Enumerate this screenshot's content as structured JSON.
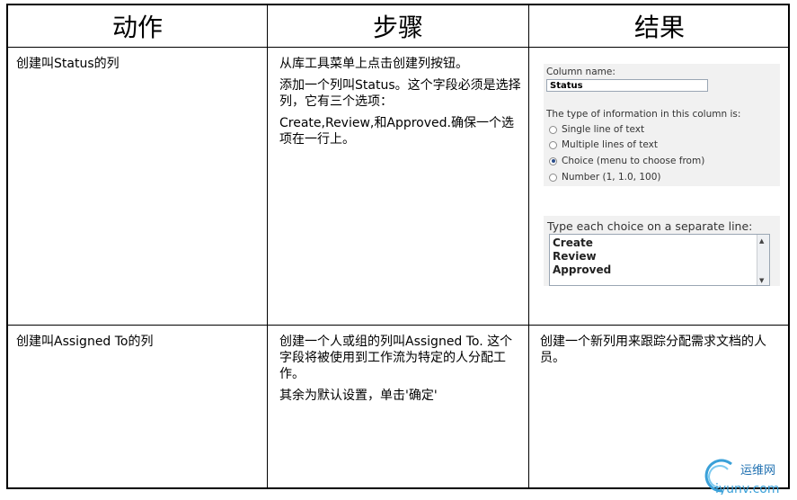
{
  "headers": [
    "动作",
    "步骤",
    "结果"
  ],
  "rows": [
    {
      "action": "创建叫Status的列",
      "steps": [
        "从库工具菜单上点击创建列按钮。",
        "添加一个列叫Status。这个字段必须是选择列，它有三个选项：",
        "Create,Review,和Approved.确保一个选项在一行上。"
      ],
      "result": ""
    },
    {
      "action": "创建叫Assigned To的列",
      "steps": [
        "创建一个人或组的列叫Assigned To. 这个字段将被使用到工作流为特定的人分配工作。",
        "其余为默认设置，单击'确定'"
      ],
      "result": "创建一个新列用来跟踪分配需求文档的人员。"
    }
  ],
  "screenshot": {
    "column_name_label": "Column name:",
    "column_name_value": "Status",
    "type_label": "The type of information in this column is:",
    "options": [
      {
        "label": "Single line of text",
        "selected": false
      },
      {
        "label": "Multiple lines of text",
        "selected": false
      },
      {
        "label": "Choice (menu to choose from)",
        "selected": true
      },
      {
        "label": "Number (1, 1.0, 100)",
        "selected": false
      }
    ],
    "choices_label": "Type each choice on a separate line:",
    "choices": [
      "Create",
      "Review",
      "Approved"
    ]
  },
  "watermark": {
    "text": "运维网",
    "url_text": "iyunv.com"
  }
}
